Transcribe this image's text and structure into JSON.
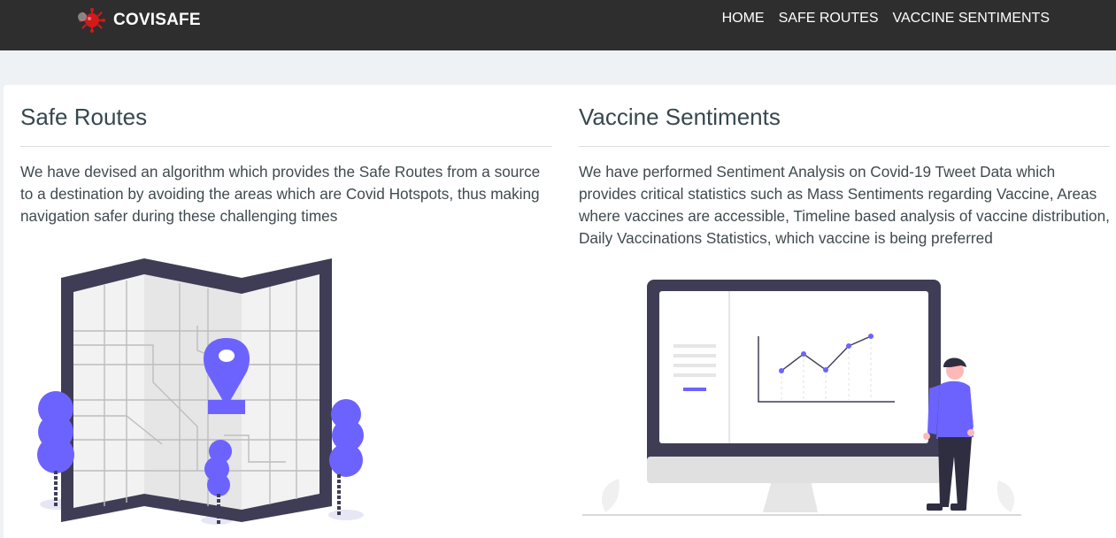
{
  "brand": {
    "name": "COVISAFE",
    "logo_icon": "virus-icon"
  },
  "nav": {
    "items": [
      {
        "label": "HOME"
      },
      {
        "label": "SAFE ROUTES"
      },
      {
        "label": "VACCINE SENTIMENTS"
      }
    ]
  },
  "sections": {
    "safe_routes": {
      "title": "Safe Routes",
      "description": "We have devised an algorithm which provides the Safe Routes from a source to a destination by avoiding the areas which are Covid Hotspots, thus making navigation safer during these challenging times",
      "illustration_icon": "map-pin-icon"
    },
    "vaccine_sentiments": {
      "title": "Vaccine Sentiments",
      "description": "We have performed Sentiment Analysis on Covid-19 Tweet Data which provides critical statistics such as Mass Sentiments regarding Vaccine, Areas where vaccines are accessible, Timeline based analysis of vaccine distribution, Daily Vaccinations Statistics, which vaccine is being preferred",
      "illustration_icon": "monitor-chart-icon"
    }
  },
  "colors": {
    "navbar": "#2e2e2e",
    "accent": "#6c63ff",
    "dark": "#3f3d56",
    "page_bg": "#eef2f5"
  }
}
